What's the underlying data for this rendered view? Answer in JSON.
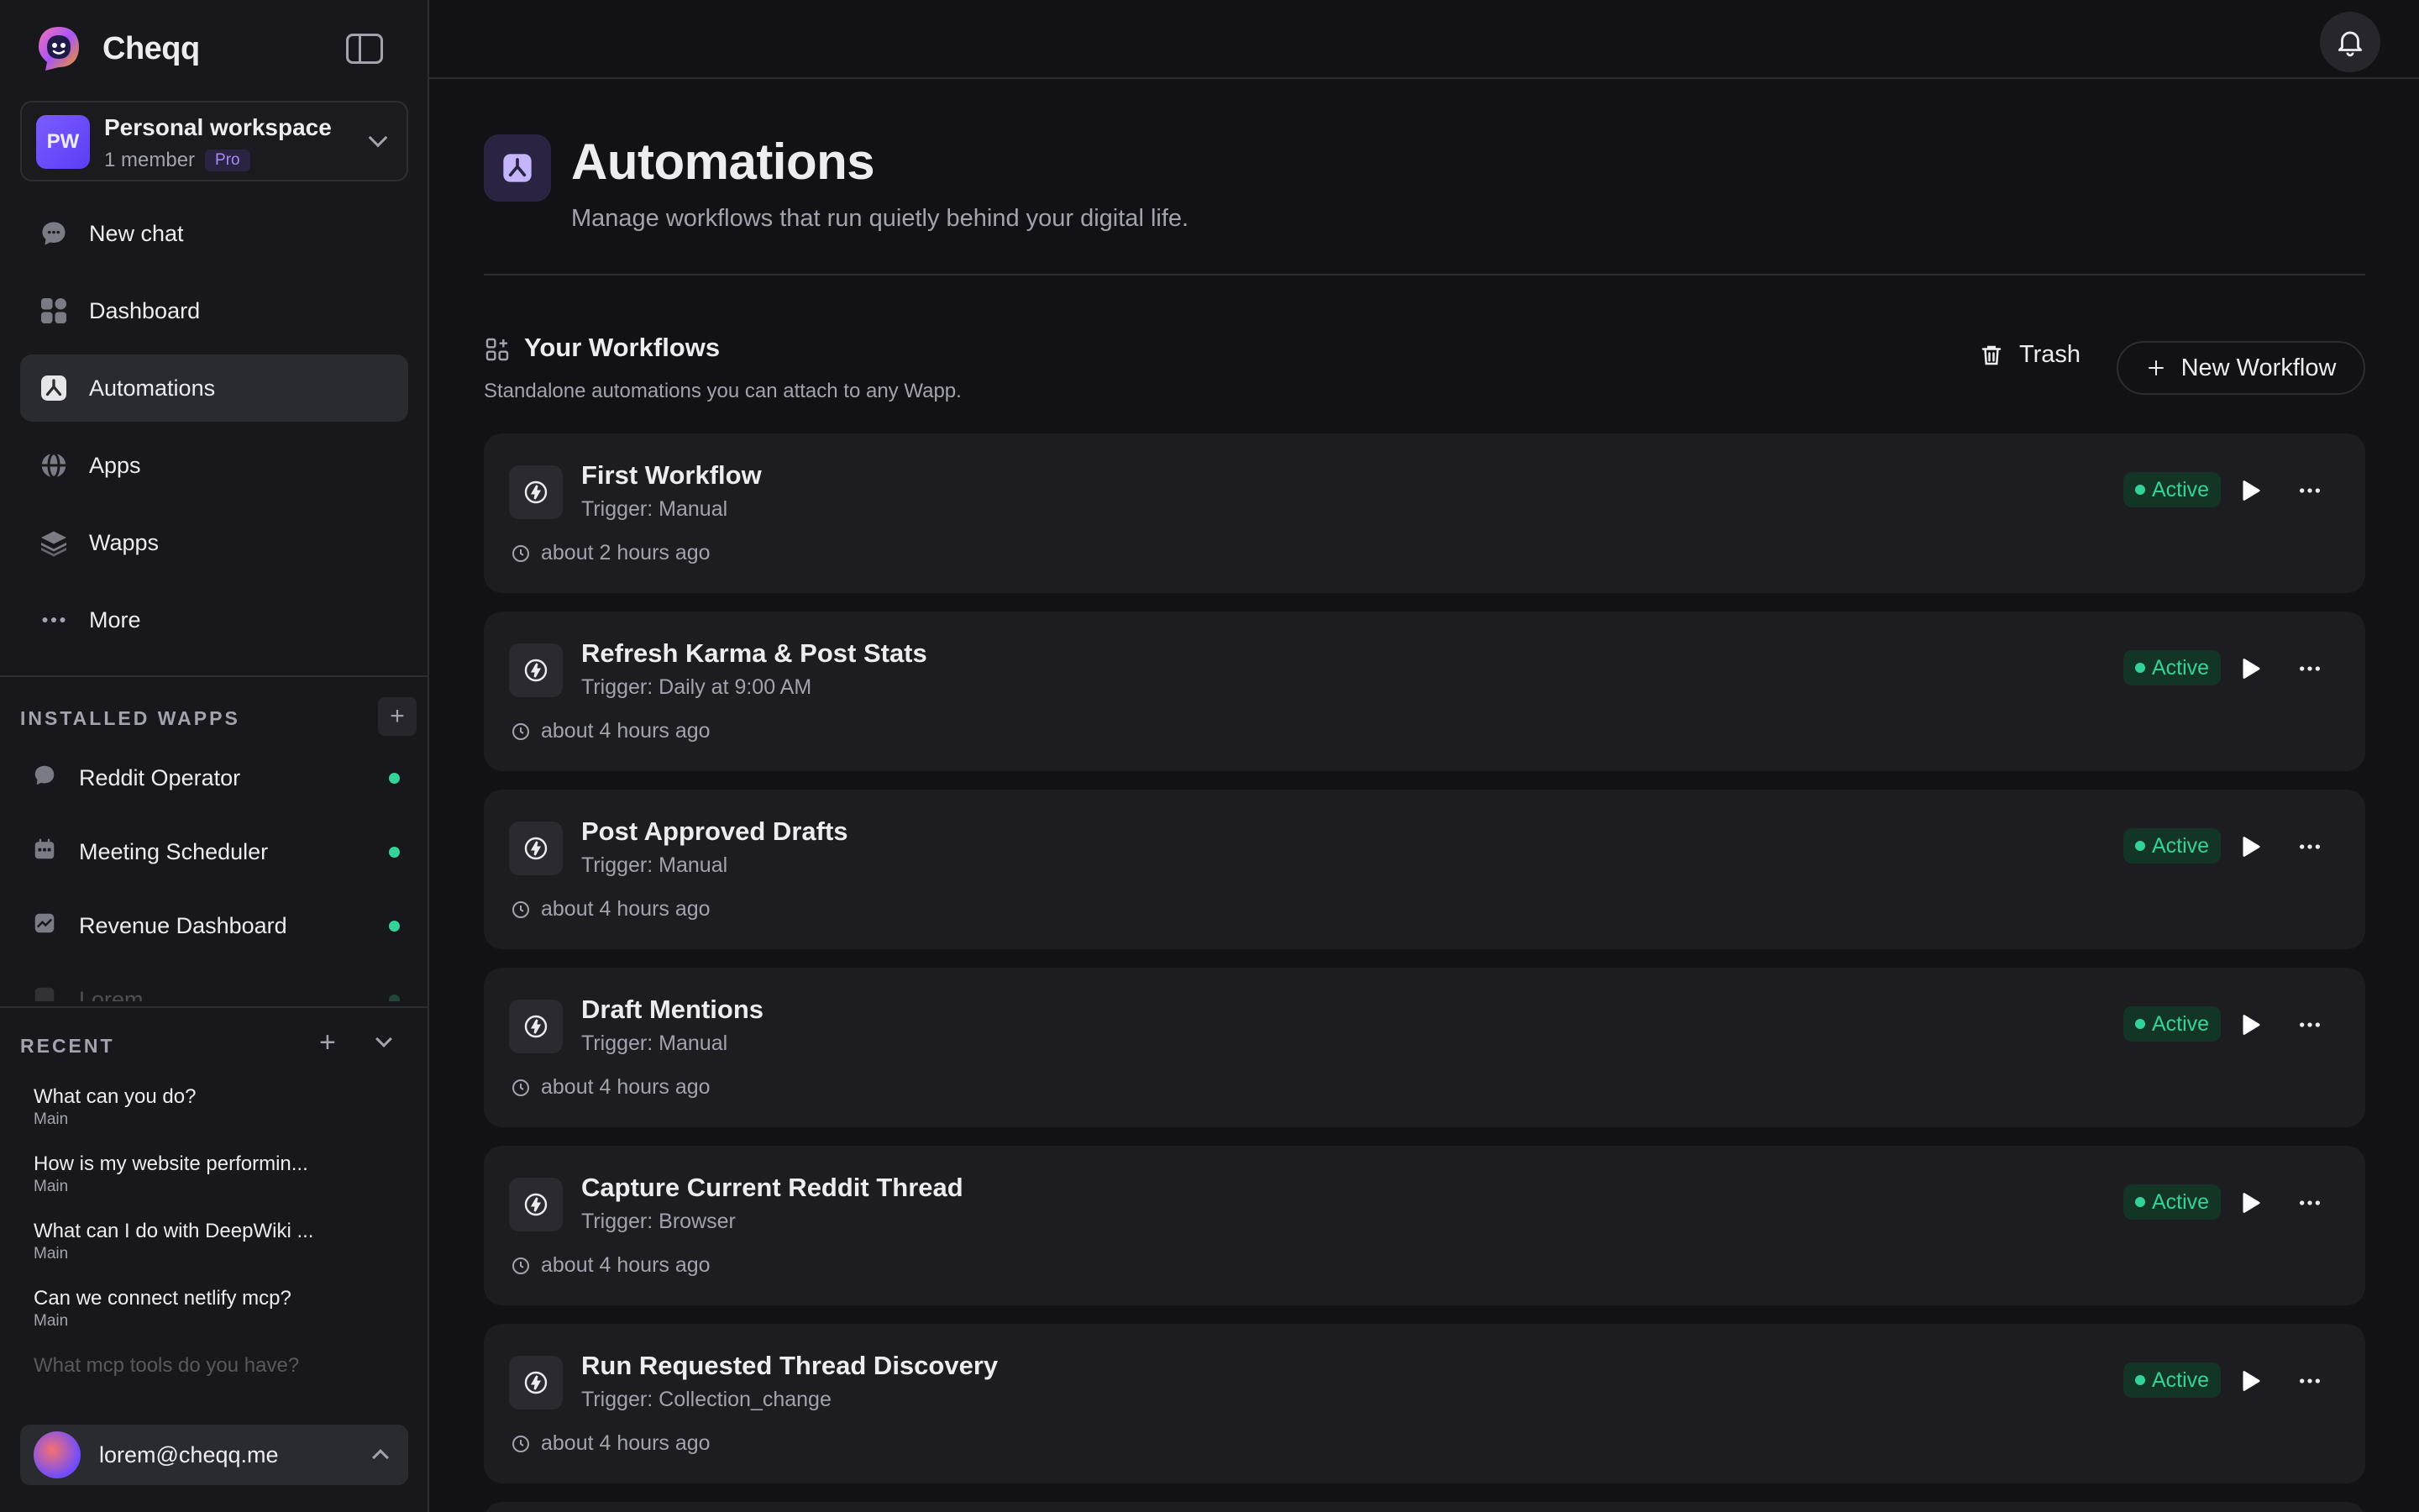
{
  "app": {
    "name": "Cheqq"
  },
  "workspace": {
    "initials": "PW",
    "name": "Personal workspace",
    "members": "1 member",
    "plan": "Pro"
  },
  "nav": [
    {
      "label": "New chat",
      "icon": "chat-bubble-icon"
    },
    {
      "label": "Dashboard",
      "icon": "grid-icon"
    },
    {
      "label": "Automations",
      "icon": "automation-icon",
      "active": true
    },
    {
      "label": "Apps",
      "icon": "globe-icon"
    },
    {
      "label": "Wapps",
      "icon": "layers-icon"
    },
    {
      "label": "More",
      "icon": "dots-icon"
    }
  ],
  "installed": {
    "label": "INSTALLED WAPPS",
    "add": "+",
    "items": [
      {
        "label": "Reddit Operator",
        "icon": "chat-bubble-icon"
      },
      {
        "label": "Meeting Scheduler",
        "icon": "calendar-icon"
      },
      {
        "label": "Revenue Dashboard",
        "icon": "chart-icon"
      },
      {
        "label": "Lorem",
        "icon": "app-icon"
      }
    ]
  },
  "recent": {
    "label": "RECENT",
    "add": "+",
    "items": [
      {
        "title": "What can you do?",
        "sub": "Main"
      },
      {
        "title": "How is my website performin...",
        "sub": "Main"
      },
      {
        "title": "What can I do with DeepWiki ...",
        "sub": "Main"
      },
      {
        "title": "Can we connect netlify mcp?",
        "sub": "Main"
      },
      {
        "title": "What mcp tools do you have?",
        "sub": ""
      }
    ]
  },
  "user": {
    "email": "lorem@cheqq.me"
  },
  "page": {
    "title": "Automations",
    "subtitle": "Manage workflows that run quietly behind your digital life."
  },
  "workflows": {
    "title": "Your Workflows",
    "subtitle": "Standalone automations you can attach to any Wapp.",
    "trash_label": "Trash",
    "new_label": "New Workflow",
    "items": [
      {
        "title": "First Workflow",
        "trigger": "Trigger: Manual",
        "time": "about 2 hours ago",
        "status": "Active"
      },
      {
        "title": "Refresh Karma & Post Stats",
        "trigger": "Trigger: Daily at 9:00 AM",
        "time": "about 4 hours ago",
        "status": "Active"
      },
      {
        "title": "Post Approved Drafts",
        "trigger": "Trigger: Manual",
        "time": "about 4 hours ago",
        "status": "Active"
      },
      {
        "title": "Draft Mentions",
        "trigger": "Trigger: Manual",
        "time": "about 4 hours ago",
        "status": "Active"
      },
      {
        "title": "Capture Current Reddit Thread",
        "trigger": "Trigger: Browser",
        "time": "about 4 hours ago",
        "status": "Active"
      },
      {
        "title": "Run Requested Thread Discovery",
        "trigger": "Trigger: Collection_change",
        "time": "about 4 hours ago",
        "status": "Active"
      }
    ]
  },
  "colors": {
    "accent": "#7c5cff",
    "active_green": "#34d399",
    "background": "#121216"
  }
}
